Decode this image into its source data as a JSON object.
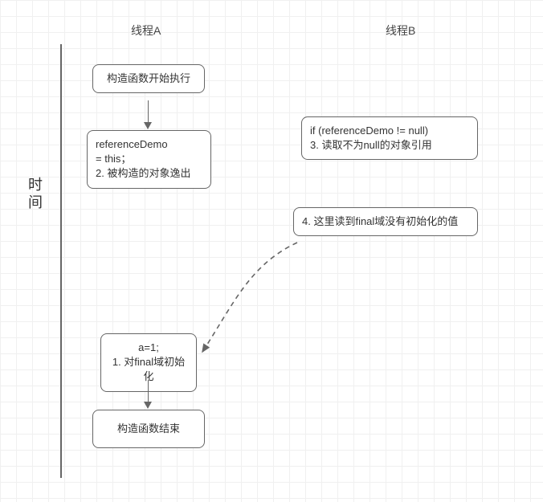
{
  "headers": {
    "threadA": "线程A",
    "threadB": "线程B"
  },
  "timeline_label": "时间",
  "nodes": {
    "ctor_start": "构造函数开始执行",
    "ref_escape_l1": "referenceDemo",
    "ref_escape_l2": "= this；",
    "ref_escape_l3": "2. 被构造的对象逸出",
    "read_ref_l1": " if (referenceDemo != null)",
    "read_ref_l2": "3. 读取不为null的对象引用",
    "read_final_l1": "4. 这里读到final域没有初始化的值",
    "a_init_l1": "a=1;",
    "a_init_l2": "1. 对final域初始化",
    "ctor_end": "构造函数结束"
  }
}
